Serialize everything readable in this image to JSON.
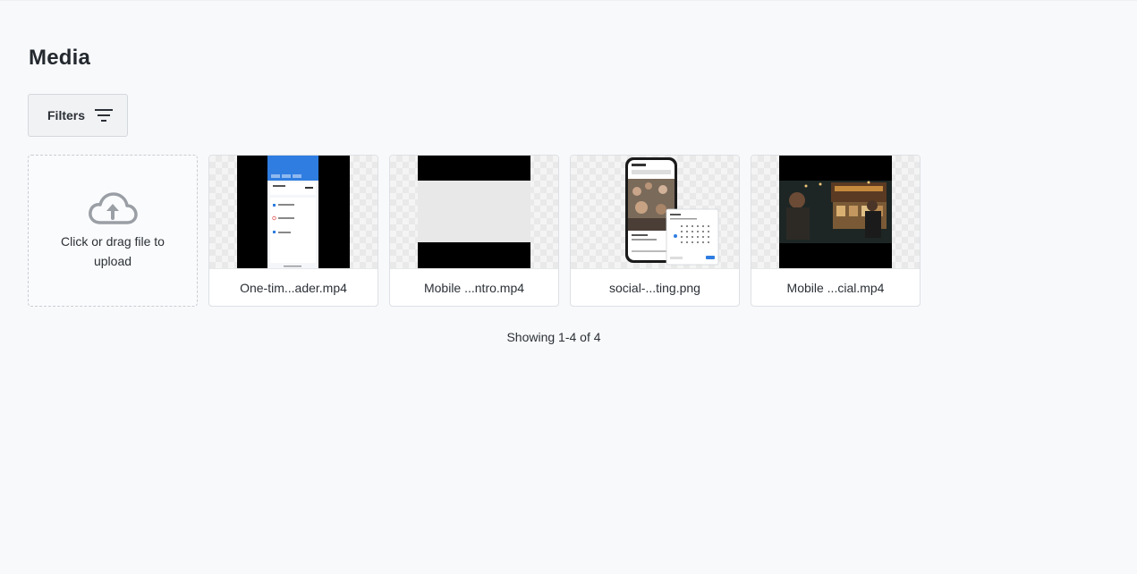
{
  "page": {
    "title": "Media"
  },
  "toolbar": {
    "filters_label": "Filters",
    "filters_icon": "filter-lines-icon"
  },
  "upload": {
    "icon": "cloud-upload-icon",
    "text": "Click or drag file to upload"
  },
  "media": {
    "items": [
      {
        "filename": "One-tim...ader.mp4",
        "thumbnail": "phone-app-screenshot"
      },
      {
        "filename": "Mobile ...ntro.mp4",
        "thumbnail": "letterboxed-gray-frame"
      },
      {
        "filename": "social-...ting.png",
        "thumbnail": "phone-with-calendar"
      },
      {
        "filename": "Mobile ...cial.mp4",
        "thumbnail": "night-street-scene"
      }
    ]
  },
  "pagination": {
    "summary": "Showing 1-4 of 4"
  },
  "colors": {
    "background": "#f8f9fb",
    "border": "#dde0e4",
    "text": "#2b3036",
    "app_blue": "#2f7de1"
  }
}
